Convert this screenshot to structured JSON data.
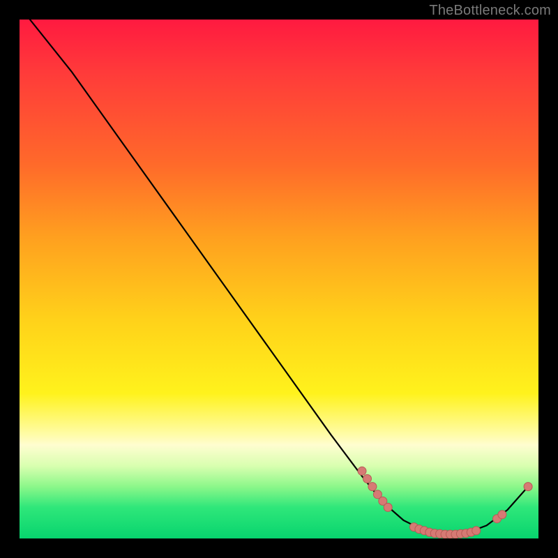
{
  "watermark": "TheBottleneck.com",
  "colors": {
    "curve": "#000000",
    "point_fill": "#d67a74",
    "point_stroke": "#b85a55",
    "gradient_top": "#ff1a40",
    "gradient_bottom": "#07d46e"
  },
  "chart_data": {
    "type": "line",
    "title": "",
    "xlabel": "",
    "ylabel": "",
    "xlim": [
      0,
      100
    ],
    "ylim": [
      0,
      100
    ],
    "curve": [
      {
        "x": 2,
        "y": 100
      },
      {
        "x": 10,
        "y": 90
      },
      {
        "x": 20,
        "y": 76
      },
      {
        "x": 30,
        "y": 62
      },
      {
        "x": 40,
        "y": 48
      },
      {
        "x": 50,
        "y": 34
      },
      {
        "x": 60,
        "y": 20
      },
      {
        "x": 66,
        "y": 12
      },
      {
        "x": 70,
        "y": 7
      },
      {
        "x": 74,
        "y": 3.5
      },
      {
        "x": 78,
        "y": 1.5
      },
      {
        "x": 82,
        "y": 0.8
      },
      {
        "x": 86,
        "y": 1.0
      },
      {
        "x": 90,
        "y": 2.5
      },
      {
        "x": 94,
        "y": 5.5
      },
      {
        "x": 98,
        "y": 10
      }
    ],
    "points": [
      {
        "x": 66,
        "y": 13
      },
      {
        "x": 67,
        "y": 11.5
      },
      {
        "x": 68,
        "y": 10
      },
      {
        "x": 69,
        "y": 8.5
      },
      {
        "x": 70,
        "y": 7.2
      },
      {
        "x": 71,
        "y": 6
      },
      {
        "x": 76,
        "y": 2.2
      },
      {
        "x": 77,
        "y": 1.8
      },
      {
        "x": 78,
        "y": 1.5
      },
      {
        "x": 79,
        "y": 1.2
      },
      {
        "x": 80,
        "y": 1.0
      },
      {
        "x": 81,
        "y": 0.9
      },
      {
        "x": 82,
        "y": 0.8
      },
      {
        "x": 83,
        "y": 0.8
      },
      {
        "x": 84,
        "y": 0.8
      },
      {
        "x": 85,
        "y": 0.9
      },
      {
        "x": 86,
        "y": 1.0
      },
      {
        "x": 87,
        "y": 1.2
      },
      {
        "x": 88,
        "y": 1.5
      },
      {
        "x": 92,
        "y": 3.8
      },
      {
        "x": 93,
        "y": 4.6
      },
      {
        "x": 98,
        "y": 10
      }
    ]
  }
}
